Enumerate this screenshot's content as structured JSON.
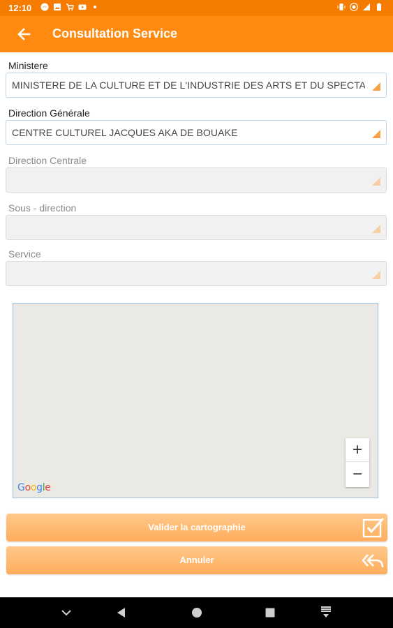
{
  "status_bar": {
    "time": "12:10",
    "left_icons": [
      "messenger-icon",
      "image-icon",
      "cart-icon",
      "youtube-icon",
      "dot"
    ],
    "right_icons": [
      "vibrate-icon",
      "wifi-icon",
      "signal-icon",
      "battery-icon"
    ]
  },
  "app_bar": {
    "title": "Consultation Service",
    "back_icon": "arrow-left-icon",
    "color": "#ff8a0f"
  },
  "form": {
    "ministere": {
      "label": "Ministere",
      "value": "MINISTERE DE LA CULTURE ET DE L'INDUSTRIE DES ARTS ET DU SPECTACLE",
      "enabled": true
    },
    "direction_generale": {
      "label": "Direction Générale",
      "value": "CENTRE CULTUREL JACQUES AKA DE BOUAKE",
      "enabled": true
    },
    "direction_centrale": {
      "label": "Direction Centrale",
      "value": "",
      "enabled": false
    },
    "sous_direction": {
      "label": "Sous - direction",
      "value": "",
      "enabled": false
    },
    "service": {
      "label": "Service",
      "value": "",
      "enabled": false
    }
  },
  "map": {
    "zoom_in": "+",
    "zoom_out": "−",
    "logo": "Google"
  },
  "buttons": {
    "validate": {
      "label": "Valider la cartographie",
      "icon": "checkbox-check-icon"
    },
    "cancel": {
      "label": "Annuler",
      "icon": "reply-all-icon"
    }
  },
  "nav_bar": {
    "icons": [
      "chevron-down-icon",
      "back-triangle-icon",
      "home-circle-icon",
      "recents-square-icon",
      "keyboard-hide-icon"
    ]
  },
  "colors": {
    "accent": "#ff8a0f",
    "status_bar": "#f57c00",
    "button_gradient_top": "#ffc88a",
    "button_gradient_bottom": "#ffad5c",
    "map_bg": "#ebe9e3"
  }
}
